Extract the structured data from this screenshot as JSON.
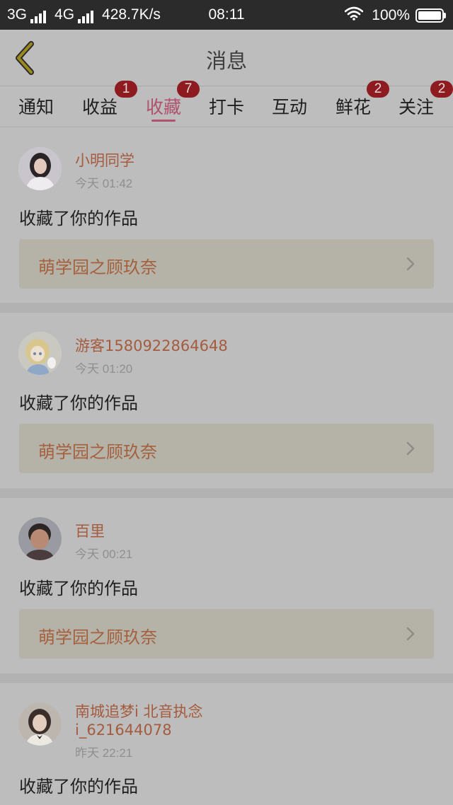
{
  "status_bar": {
    "network1": "3G",
    "network2": "4G",
    "speed": "428.7K/s",
    "time": "08:11",
    "battery": "100%"
  },
  "header": {
    "title": "消息"
  },
  "tabs": [
    {
      "label": "通知",
      "badge": ""
    },
    {
      "label": "收益",
      "badge": "1"
    },
    {
      "label": "收藏",
      "badge": "7",
      "active": true
    },
    {
      "label": "打卡",
      "badge": ""
    },
    {
      "label": "互动",
      "badge": ""
    },
    {
      "label": "鲜花",
      "badge": "2"
    },
    {
      "label": "关注",
      "badge": "2"
    }
  ],
  "feed": [
    {
      "user": "小明同学",
      "time": "今天 01:42",
      "action": "收藏了你的作品",
      "work": "萌学园之顾玖奈"
    },
    {
      "user": "游客1580922864648",
      "time": "今天 01:20",
      "action": "收藏了你的作品",
      "work": "萌学园之顾玖奈"
    },
    {
      "user": "百里",
      "time": "今天 00:21",
      "action": "收藏了你的作品",
      "work": "萌学园之顾玖奈"
    },
    {
      "user": "南城追梦i 北音执念",
      "user_line2": "i_621644078",
      "time": "昨天 22:21",
      "action": "收藏了你的作品"
    }
  ],
  "colors": {
    "accent": "#b0516e",
    "badge": "#8e1b20",
    "username": "#a55b3e",
    "background": "#bdbdbd"
  },
  "icons": {
    "back": "chevron-left-icon",
    "link": "chevron-right-icon",
    "wifi": "wifi-icon",
    "battery": "battery-icon"
  }
}
